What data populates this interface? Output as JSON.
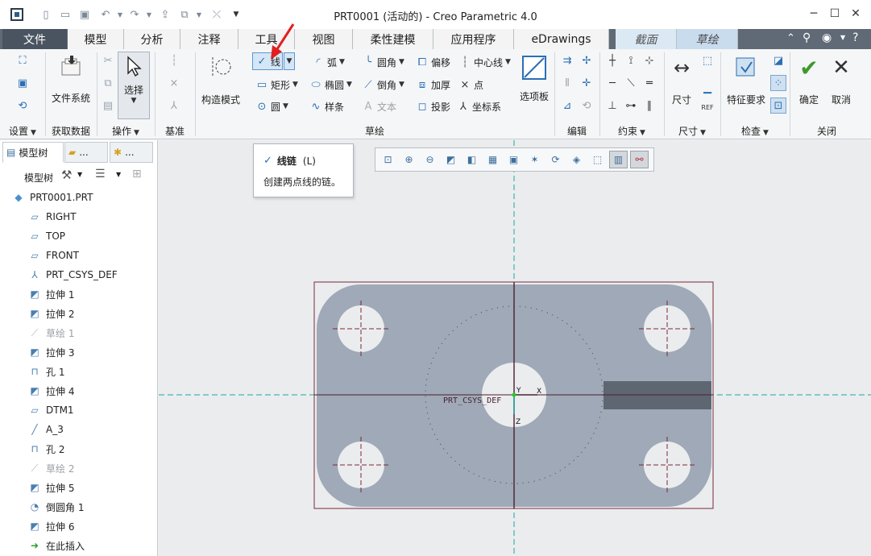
{
  "window": {
    "title": "PRT0001 (活动的) - Creo Parametric 4.0"
  },
  "ribbon_tabs": [
    {
      "label": "文件"
    },
    {
      "label": "模型"
    },
    {
      "label": "分析"
    },
    {
      "label": "注释"
    },
    {
      "label": "工具"
    },
    {
      "label": "视图"
    },
    {
      "label": "柔性建模"
    },
    {
      "label": "应用程序"
    },
    {
      "label": "eDrawings"
    },
    {
      "label": "截面"
    },
    {
      "label": "草绘"
    }
  ],
  "ribbon": {
    "file_system": "文件系统",
    "select": "选择",
    "construction_mode": "构造模式",
    "sketch": {
      "line": "线",
      "arc": "弧",
      "fillet": "圆角",
      "offset": "偏移",
      "centerline": "中心线",
      "rectangle": "矩形",
      "ellipse": "椭圆",
      "chamfer": "倒角",
      "thicken": "加厚",
      "point": "点",
      "circle": "圆",
      "spline": "样条",
      "text": "文本",
      "project": "投影",
      "csys": "坐标系",
      "palette": "选项板"
    },
    "dimension": "尺寸",
    "feature_req": "特征要求",
    "ok": "确定",
    "cancel": "取消",
    "groups": {
      "setup": "设置",
      "get_data": "获取数据",
      "operations": "操作",
      "datum": "基准",
      "sketching": "草绘",
      "editing": "编辑",
      "constrain": "约束",
      "dimension": "尺寸",
      "inspect": "检查",
      "close": "关闭"
    }
  },
  "tooltip": {
    "title": "线链",
    "shortcut": "(L)",
    "desc": "创建两点线的链。"
  },
  "panel": {
    "tab1": "模型树",
    "tab2": "...",
    "tab3": "...",
    "tree_label": "模型树"
  },
  "tree": [
    {
      "label": "PRT0001.PRT",
      "icon": "part-icon",
      "gray": false
    },
    {
      "label": "RIGHT",
      "icon": "datum-plane-icon",
      "gray": false
    },
    {
      "label": "TOP",
      "icon": "datum-plane-icon",
      "gray": false
    },
    {
      "label": "FRONT",
      "icon": "datum-plane-icon",
      "gray": false
    },
    {
      "label": "PRT_CSYS_DEF",
      "icon": "csys-icon",
      "gray": false
    },
    {
      "label": "拉伸 1",
      "icon": "extrude-icon",
      "gray": false
    },
    {
      "label": "拉伸 2",
      "icon": "extrude-icon",
      "gray": false
    },
    {
      "label": "草绘 1",
      "icon": "sketch-icon",
      "gray": true
    },
    {
      "label": "拉伸 3",
      "icon": "extrude-icon",
      "gray": false
    },
    {
      "label": "孔 1",
      "icon": "hole-icon",
      "gray": false
    },
    {
      "label": "拉伸 4",
      "icon": "extrude-icon",
      "gray": false
    },
    {
      "label": "DTM1",
      "icon": "datum-plane-icon",
      "gray": false
    },
    {
      "label": "A_3",
      "icon": "axis-icon",
      "gray": false
    },
    {
      "label": "孔 2",
      "icon": "hole-icon",
      "gray": false
    },
    {
      "label": "草绘 2",
      "icon": "sketch-icon",
      "gray": true
    },
    {
      "label": "拉伸 5",
      "icon": "extrude-icon",
      "gray": false
    },
    {
      "label": "倒圆角 1",
      "icon": "round-icon",
      "gray": false
    },
    {
      "label": "拉伸 6",
      "icon": "extrude-icon",
      "gray": false
    },
    {
      "label": "在此插入",
      "icon": "insert-arrow-icon",
      "gray": false
    }
  ],
  "canvas": {
    "csys_label": "PRT_CSYS_DEF",
    "axis_x": "X",
    "axis_y": "Y",
    "axis_z": "Z"
  },
  "colors": {
    "accent": "#2a6fb5",
    "part_fill": "#9fa9b7",
    "centerline": "#19a7a0"
  }
}
